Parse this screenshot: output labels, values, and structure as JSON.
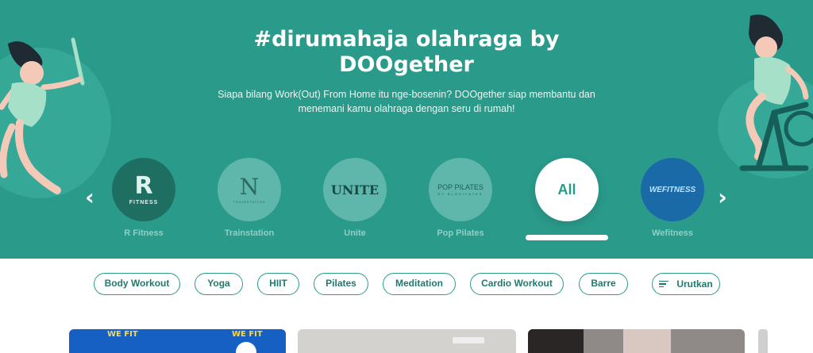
{
  "hero": {
    "title_line1": "#dirumahaja olahraga by",
    "title_line2": "DOOgether",
    "subtitle_line1": "Siapa bilang Work(Out) From Home itu nge-bosenin? DOOgether siap membantu dan",
    "subtitle_line2": "menemani kamu olahraga dengan seru di rumah!",
    "bg_color": "#2a9a8b"
  },
  "carousel": {
    "prev_icon": "‹",
    "next_icon": "›",
    "brands": [
      {
        "name": "R Fitness",
        "logo_main": "R",
        "logo_sub": "FITNESS"
      },
      {
        "name": "Trainstation",
        "logo_main": "N",
        "logo_sub": "TRAINSTATION"
      },
      {
        "name": "Unite",
        "logo_main": "UNITE"
      },
      {
        "name": "Pop Pilates",
        "logo_main": "POP PILATES",
        "logo_sub": "BY BLOGILATES"
      },
      {
        "name": "All",
        "logo_main": "All",
        "active": true
      },
      {
        "name": "Wefitness",
        "logo_main": "WEFITNESS"
      }
    ]
  },
  "filters": {
    "chips": [
      "Body Workout",
      "Yoga",
      "HIIT",
      "Pilates",
      "Meditation",
      "Cardio Workout",
      "Barre"
    ],
    "sort_label": "Urutkan"
  },
  "cards": {
    "card1_text_a": "WE FIT",
    "card1_text_b": "WE FIT"
  }
}
